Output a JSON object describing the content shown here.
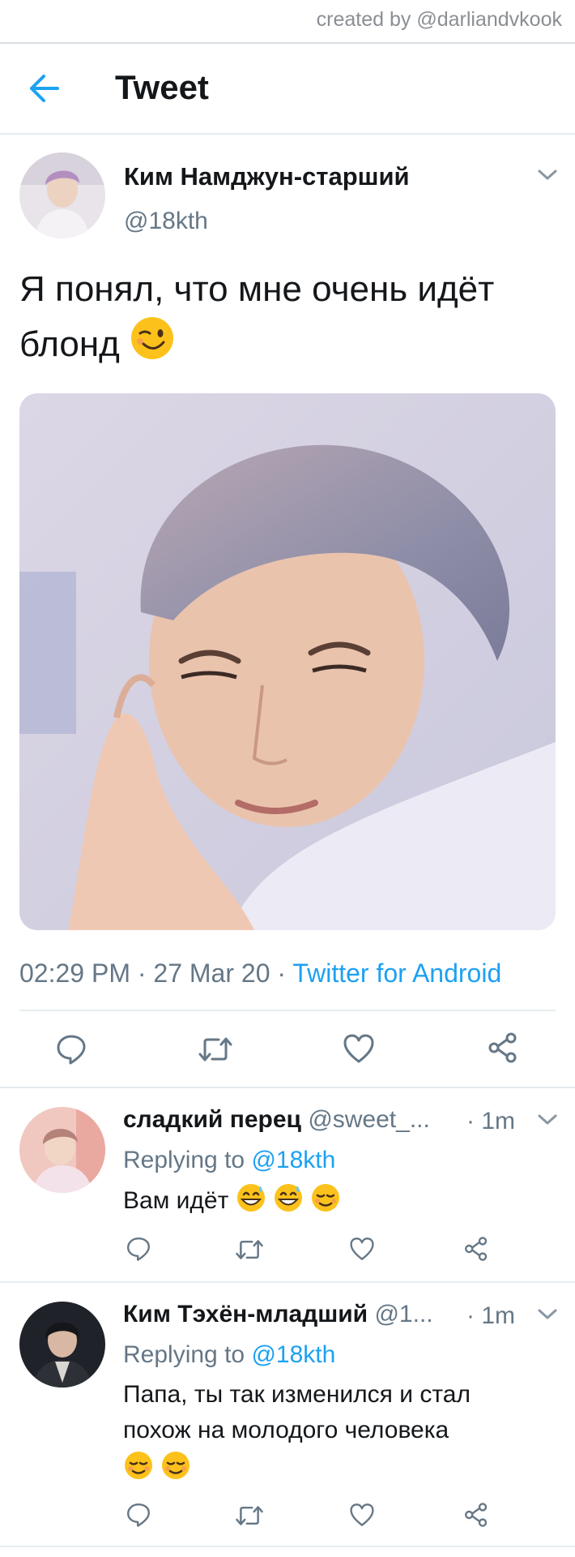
{
  "watermark": "created by @darliandvkook",
  "header": {
    "title": "Tweet"
  },
  "tweet": {
    "author_name": "Ким Намджун-старший",
    "author_handle": "@18kth",
    "text": "Я понял, что мне очень идёт блонд",
    "time": "02:29 PM",
    "date": "27 Mar 20",
    "source": "Twitter for Android",
    "separator": "·"
  },
  "replies": [
    {
      "name": "сладкий перец",
      "handle": "@sweet_...",
      "time": "· 1m",
      "replying_label": "Replying to",
      "replying_to": "@18kth",
      "text": "Вам идёт"
    },
    {
      "name": "Ким Тэхён-младший",
      "handle": "@1...",
      "time": "· 1m",
      "replying_label": "Replying to",
      "replying_to": "@18kth",
      "text_line1": "Папа, ты так изменился и стал",
      "text_line2": "похож на молодого человека"
    }
  ],
  "colors": {
    "accent": "#1da1f2",
    "secondary": "#657786",
    "divider": "#e6ecf0"
  },
  "icons": [
    "back-arrow-icon",
    "chevron-down-icon",
    "reply-icon",
    "retweet-icon",
    "like-icon",
    "share-icon",
    "wink-emoji",
    "grinning-sweat-emoji",
    "relieved-emoji"
  ]
}
